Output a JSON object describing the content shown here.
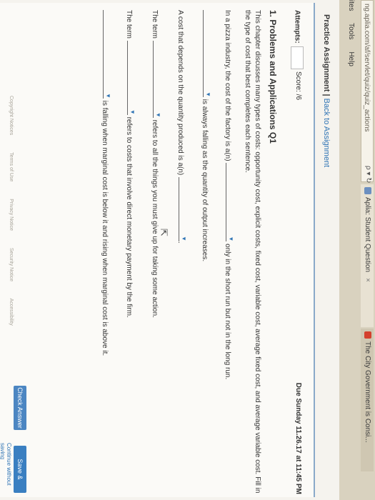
{
  "browser": {
    "address": "ng.aplia.com/af/servlet/quiz/quiz_actions",
    "address_controls": "ρ ▾ ↻",
    "tabs": [
      {
        "label": "Aplia: Student Question",
        "close": "×"
      },
      {
        "label": "The City Government is Consi..."
      }
    ],
    "menu": [
      "ites",
      "Tools",
      "Help"
    ]
  },
  "page": {
    "practice_title": "Practice Assignment",
    "separator": " | ",
    "back_link": "Back to Assignment",
    "attempts_label": "Attempts:",
    "score_label": "Score: /6",
    "due": "Due Sunday 11.26.17 at 11:45 PM",
    "question_title": "1. Problems and Applications Q1",
    "instructions": "This chapter discusses many types of costs: opportunity cost, explicit costs, fixed cost, variable cost, average fixed cost, and average variable cost. Fill in the type of cost that best completes each sentence.",
    "sentences": [
      {
        "before": "In a pizza industry, the cost of the factory is a(n)",
        "after": "only in the short run but not in the long run."
      },
      {
        "before": "",
        "after": "is always falling as the quantity of output increases."
      },
      {
        "before": "A cost that depends on the quantity produced is a(n)",
        "after": "."
      },
      {
        "before": "The term",
        "after": "refers to all the things you must give up for taking some action."
      },
      {
        "before": "The term",
        "after": "refers to costs that involve direct monetary payment by the firm."
      },
      {
        "before": "",
        "after": "is falling when marginal cost is below it and rising when marginal cost is above it."
      }
    ],
    "check_answer": "Check Answer",
    "save_continue": "Save & Continue",
    "continue_without": "Continue without saving",
    "footer": [
      "Copyright Notices",
      "Terms of Use",
      "Privacy Notice",
      "Security Notice",
      "Accessibility"
    ]
  }
}
